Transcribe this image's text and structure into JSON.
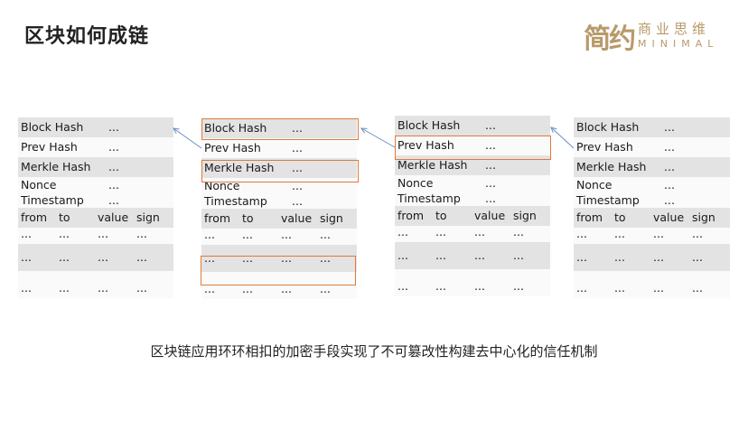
{
  "slide_title": "区块如何成链",
  "logo": {
    "mark": "简约",
    "cn": "商业思维",
    "en": "MINIMAL"
  },
  "block_labels": {
    "block_hash": "Block Hash",
    "prev_hash": "Prev Hash",
    "merkle_hash": "Merkle Hash",
    "nonce": "Nonce",
    "timestamp": "Timestamp",
    "ellipsis": "...",
    "col_from": "from",
    "col_to": "to",
    "col_value": "value",
    "col_sign": "sign"
  },
  "caption": "区块链应用环环相扣的加密手段实现了不可篡改性构建去中心化的信任机制",
  "colors": {
    "highlight": "#e07a3c",
    "arrow": "#6a8fc4",
    "logo": "#b89a6a"
  }
}
